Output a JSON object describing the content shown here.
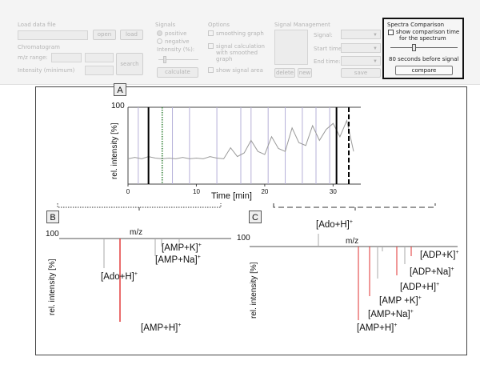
{
  "toolbar": {
    "load": {
      "title": "Load data file",
      "open_label": "open",
      "load_label": "load"
    },
    "chromatogram": {
      "title": "Chromatogram",
      "mz_range_label": "m/z range:",
      "intensity_label": "Intensity (minimum)",
      "search_label": "search"
    },
    "signals": {
      "title": "Signals",
      "positive_label": "positive",
      "negative_label": "negative",
      "intensity_label": "Intensity (%):",
      "calculate_label": "calculate"
    },
    "options": {
      "title": "Options",
      "smoothing_label": "smoothing graph",
      "calc_line1": "signal calculation",
      "calc_line2": "with smoothed",
      "calc_line3": "graph",
      "show_areas_label": "show signal area"
    },
    "signal_management": {
      "title": "Signal Management",
      "signal_label": "Signal:",
      "start_label": "Start time:",
      "end_label": "End time:",
      "delete_label": "delete",
      "new_label": "new",
      "save_label": "save"
    },
    "spectra_comparison": {
      "title": "Spectra Comparison",
      "show_line1": "show comparison time",
      "show_line2": "for the spectrum",
      "seconds_text": "80 seconds before signal",
      "compare_label": "compare"
    }
  },
  "panels": {
    "a_label": "A",
    "b_label": "B",
    "c_label": "C"
  },
  "chromatogram_chart": {
    "y_max_label": "100",
    "ylabel": "rel. intensity [%]",
    "xlabel": "Time [min]",
    "x_ticks": [
      "0",
      "10",
      "20",
      "30"
    ]
  },
  "spectrum_b": {
    "y_max_label": "100",
    "ylabel": "rel. intensity [%]",
    "xlabel": "m/z",
    "labels": {
      "amp_k": "[AMP+K]",
      "amp_na": "[AMP+Na]",
      "ado_h": "[Ado+H]",
      "amp_h": "[AMP+H]"
    },
    "charge": "+"
  },
  "spectrum_c": {
    "y_max_label": "100",
    "ylabel": "rel. intensity [%]",
    "xlabel": "m/z",
    "labels": {
      "ado_h": "[Ado+H]",
      "adp_k": "[ADP+K]",
      "adp_na": "[ADP+Na]",
      "adp_h": "[ADP+H]",
      "amp_k": "[AMP +K]",
      "amp_na": "[AMP+Na]",
      "amp_h": "[AMP+H]"
    },
    "charge": "+"
  },
  "colors": {
    "trace": "#9a9a9a",
    "signal_line": "#b6b0d8",
    "red_peak": "#e03030",
    "marker": "#000000",
    "dotted_marker": "#2e7d32"
  },
  "chart_data": {
    "type": "line",
    "x": [
      0,
      1,
      2,
      3,
      4,
      5,
      6,
      7,
      8,
      9,
      10,
      11,
      12,
      13,
      14,
      15,
      16,
      17,
      18,
      19,
      20,
      21,
      22,
      23,
      24,
      25,
      26,
      27,
      28,
      29,
      30,
      31,
      32,
      33
    ],
    "y": [
      30,
      32,
      30,
      33,
      31,
      30,
      31,
      30,
      32,
      30,
      31,
      30,
      33,
      31,
      30,
      45,
      33,
      38,
      55,
      40,
      36,
      60,
      44,
      40,
      72,
      52,
      48,
      75,
      55,
      70,
      78,
      60,
      82,
      40
    ],
    "xlim": [
      0,
      33
    ],
    "ylim": [
      0,
      100
    ],
    "xlabel": "Time [min]",
    "ylabel": "rel. intensity [%]"
  }
}
